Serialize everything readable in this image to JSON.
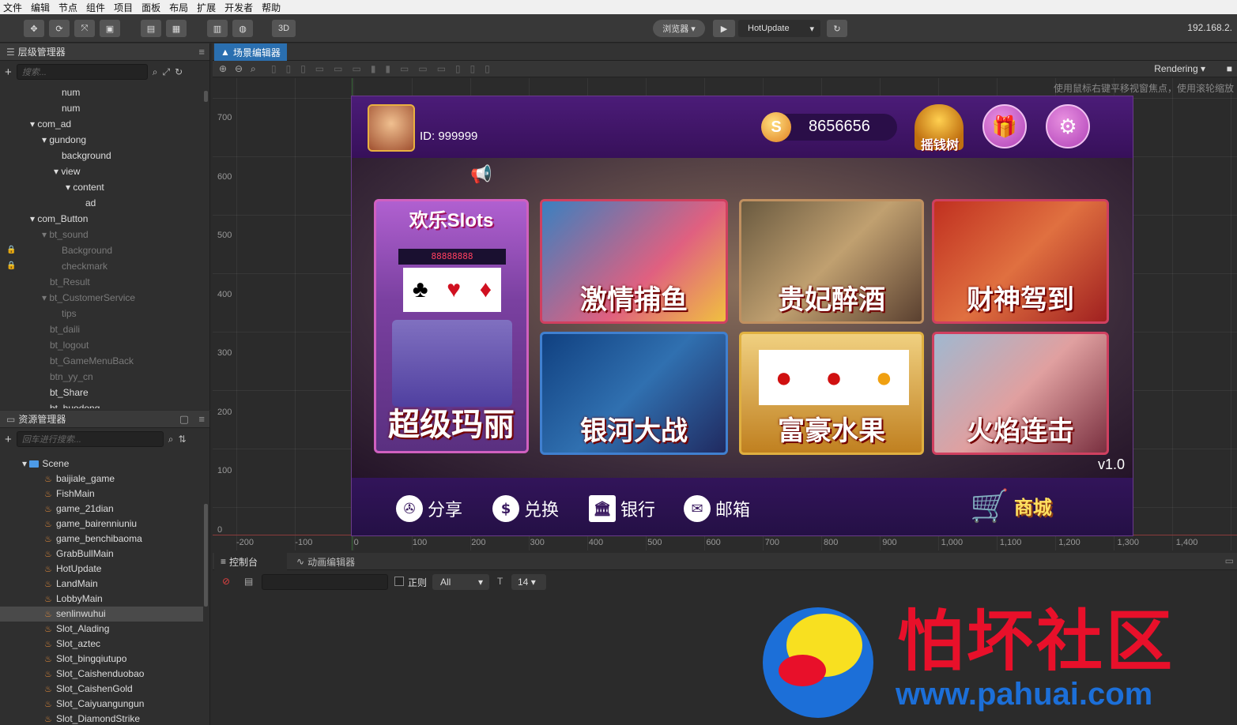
{
  "menu": [
    "文件",
    "编辑",
    "节点",
    "组件",
    "项目",
    "面板",
    "布局",
    "扩展",
    "开发者",
    "帮助"
  ],
  "toolbar": {
    "mode3d": "3D",
    "browser_label": "浏览器 ▾",
    "play_icon": "play-icon",
    "scene_select": "HotUpdate",
    "refresh_icon": "refresh-icon",
    "ip": "192.168.2."
  },
  "hierarchy": {
    "title": "层级管理器",
    "search_placeholder": "搜索...",
    "nodes": [
      {
        "label": "num",
        "indent": 78,
        "dim": false
      },
      {
        "label": "num",
        "indent": 78,
        "dim": false
      },
      {
        "label": "▾ com_ad",
        "indent": 38,
        "dim": false
      },
      {
        "label": "▾ gundong",
        "indent": 53,
        "dim": false
      },
      {
        "label": "background",
        "indent": 78,
        "dim": false
      },
      {
        "label": "▾ view",
        "indent": 68,
        "dim": false
      },
      {
        "label": "▾ content",
        "indent": 83,
        "dim": false
      },
      {
        "label": "ad",
        "indent": 108,
        "dim": false
      },
      {
        "label": "▾ com_Button",
        "indent": 38,
        "dim": false
      },
      {
        "label": "▾ bt_sound",
        "indent": 53,
        "dim": true
      },
      {
        "label": "Background",
        "indent": 78,
        "dim": true,
        "lock": true
      },
      {
        "label": "checkmark",
        "indent": 78,
        "dim": true,
        "lock": true
      },
      {
        "label": "bt_Result",
        "indent": 63,
        "dim": true
      },
      {
        "label": "▾ bt_CustomerService",
        "indent": 53,
        "dim": true
      },
      {
        "label": "tips",
        "indent": 78,
        "dim": true
      },
      {
        "label": "bt_daili",
        "indent": 63,
        "dim": true
      },
      {
        "label": "bt_logout",
        "indent": 63,
        "dim": true
      },
      {
        "label": "bt_GameMenuBack",
        "indent": 63,
        "dim": true
      },
      {
        "label": "btn_yy_cn",
        "indent": 63,
        "dim": true
      },
      {
        "label": "bt_Share",
        "indent": 63,
        "dim": false
      },
      {
        "label": "bt_huodong",
        "indent": 63,
        "dim": false
      }
    ]
  },
  "assets": {
    "title": "资源管理器",
    "search_placeholder": "回车进行搜索...",
    "folder": "Scene",
    "files": [
      "baijiale_game",
      "FishMain",
      "game_21dian",
      "game_bairenniuniu",
      "game_benchibaoma",
      "GrabBullMain",
      "HotUpdate",
      "LandMain",
      "LobbyMain",
      "senlinwuhui",
      "Slot_Alading",
      "Slot_aztec",
      "Slot_bingqiutupo",
      "Slot_Caishenduobao",
      "Slot_CaishenGold",
      "Slot_Caiyuangungun",
      "Slot_DiamondStrike"
    ],
    "selected": "senlinwuhui"
  },
  "scene": {
    "tab": "场景编辑器",
    "rendering": "Rendering",
    "hint": "使用鼠标右键平移视窗焦点，使用滚轮缩放",
    "y_labels": [
      "700",
      "600",
      "500",
      "400",
      "300",
      "200",
      "100",
      "0"
    ],
    "x_labels": [
      "-200",
      "-100",
      "0",
      "100",
      "200",
      "300",
      "400",
      "500",
      "600",
      "700",
      "800",
      "900",
      "1,000",
      "1,100",
      "1,200",
      "1,300",
      "1,400"
    ]
  },
  "game": {
    "player_id": "ID: 999999",
    "coins": "8656656",
    "tree_label": "摇钱树",
    "gift_icon": "gift-icon",
    "settings_icon": "gear-icon",
    "slots_title": "欢乐Slots",
    "slots_reel": "88888888",
    "big_card": "超级玛丽",
    "cards": [
      "激情捕鱼",
      "贵妃醉酒",
      "财神驾到",
      "银河大战",
      "富豪水果",
      "火焰连击"
    ],
    "version": "v1.0",
    "bottom": [
      {
        "icon": "share-icon",
        "label": "分享"
      },
      {
        "icon": "exchange-icon",
        "label": "兑换"
      },
      {
        "icon": "bank-icon",
        "label": "银行"
      },
      {
        "icon": "mail-icon",
        "label": "邮箱"
      }
    ],
    "shop": "商城"
  },
  "console": {
    "tabs": [
      "控制台",
      "动画编辑器"
    ],
    "regex_label": "正则",
    "level_select": "All",
    "font_size": "14"
  },
  "watermark": {
    "title": "怕坏社区",
    "url": "www.pahuai.com"
  }
}
